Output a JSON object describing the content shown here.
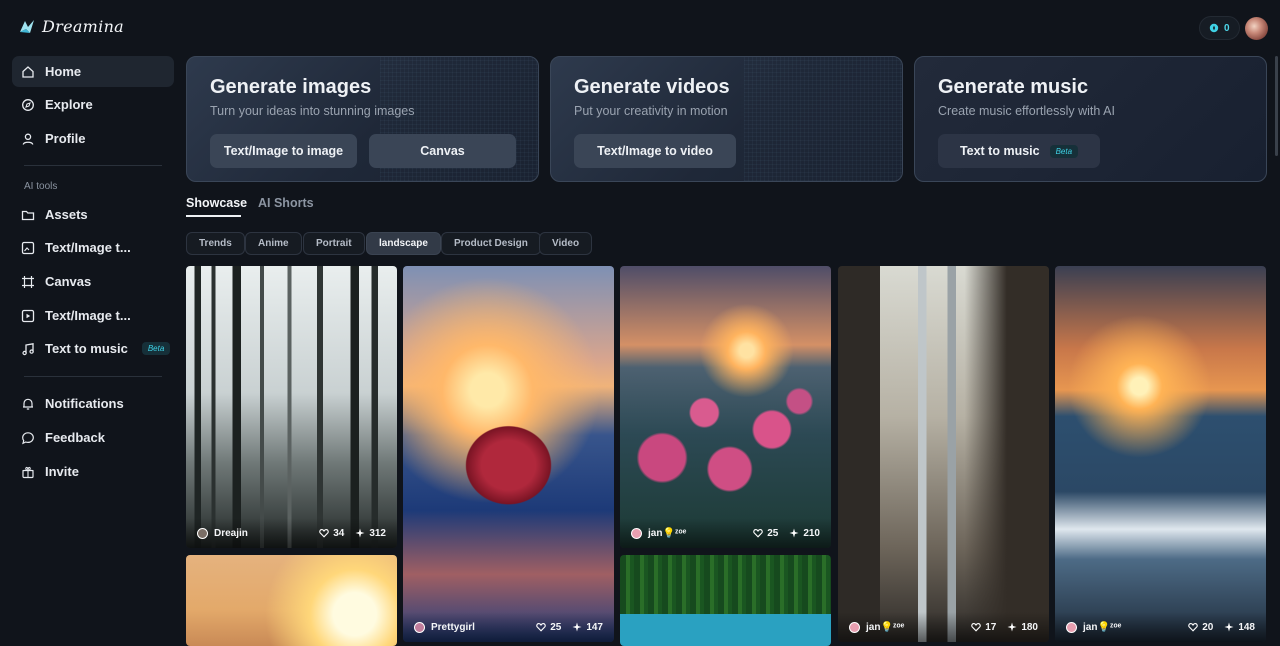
{
  "app": {
    "brand": "Dreamina",
    "credits": "0"
  },
  "sidebar": {
    "items": [
      {
        "label": "Home",
        "icon": "home-icon",
        "active": true
      },
      {
        "label": "Explore",
        "icon": "compass-icon"
      },
      {
        "label": "Profile",
        "icon": "user-icon"
      }
    ],
    "tools_label": "AI tools",
    "tools": [
      {
        "label": "Assets",
        "icon": "folder-icon"
      },
      {
        "label": "Text/Image t...",
        "icon": "image-generate-icon"
      },
      {
        "label": "Canvas",
        "icon": "canvas-icon"
      },
      {
        "label": "Text/Image t...",
        "icon": "video-generate-icon"
      },
      {
        "label": "Text to music",
        "icon": "music-icon",
        "badge": "Beta"
      }
    ],
    "bottom": [
      {
        "label": "Notifications",
        "icon": "bell-icon"
      },
      {
        "label": "Feedback",
        "icon": "chat-icon"
      },
      {
        "label": "Invite",
        "icon": "gift-icon"
      }
    ]
  },
  "hero": [
    {
      "title": "Generate images",
      "subtitle": "Turn your ideas into stunning images",
      "buttons": [
        "Text/Image to image",
        "Canvas"
      ]
    },
    {
      "title": "Generate videos",
      "subtitle": "Put your creativity in motion",
      "buttons": [
        "Text/Image to video"
      ]
    },
    {
      "title": "Generate music",
      "subtitle": "Create music effortlessly with AI",
      "buttons": [
        "Text to music"
      ],
      "badge": "Beta"
    }
  ],
  "tabs": [
    "Showcase",
    "AI Shorts"
  ],
  "filters": [
    "Trends",
    "Anime",
    "Portrait",
    "landscape",
    "Product Design",
    "Video"
  ],
  "active_filter": "landscape",
  "gallery": [
    {
      "user": "Dreajin",
      "likes": "34",
      "boosts": "312"
    },
    {
      "user": "Prettygirl",
      "likes": "25",
      "boosts": "147"
    },
    {
      "user": "jan💡ᶻᵒᵉ",
      "likes": "25",
      "boosts": "210"
    },
    {
      "user": "jan💡ᶻᵒᵉ",
      "likes": "17",
      "boosts": "180"
    },
    {
      "user": "jan💡ᶻᵒᵉ",
      "likes": "20",
      "boosts": "148"
    }
  ],
  "colors": {
    "accent": "#3fd2e6",
    "background": "#10141b",
    "card": "#1f2838"
  }
}
